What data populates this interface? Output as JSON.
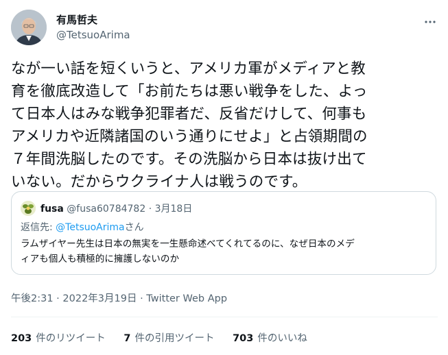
{
  "author": {
    "display_name": "有馬哲夫",
    "handle": "@TetsuoArima"
  },
  "more_icon": "more-horizontal-icon",
  "tweet": {
    "text": "なが一い話を短くいうと、アメリカ軍がメディアと教\n育を徹底改造して「お前たちは悪い戦争をした、よっ\nて日本人はみな戦争犯罪者だ、反省だけして、何事も\nアメリカや近隣諸国のいう通りにせよ」と占領期間の\n７年間洗脳したのです。その洗脳から日本は抜け出て\nいない。だからウクライナ人は戦うのです。"
  },
  "quote": {
    "display_name": "fusa",
    "handle": "@fusa60784782",
    "separator": "·",
    "date": "3月18日",
    "reply_prefix": "返信先: ",
    "reply_mention": "@TetsuoArima",
    "reply_suffix": "さん",
    "text": "ラムザイヤー先生は日本の無実を一生懸命述べてくれてるのに、なぜ日本のメデ\nィアも個人も積極的に擁護しないのか"
  },
  "meta": {
    "time": "午後2:31",
    "separator": " · ",
    "date": "2022年3月19日",
    "separator2": " · ",
    "source": "Twitter Web App"
  },
  "stats": [
    {
      "count": "203",
      "label": "件のリツイート"
    },
    {
      "count": "7",
      "label": "件の引用ツイート"
    },
    {
      "count": "703",
      "label": "件のいいね"
    }
  ],
  "colors": {
    "text": "#0f1419",
    "secondary": "#536471",
    "link": "#1d9bf0",
    "border": "#cfd9de"
  }
}
